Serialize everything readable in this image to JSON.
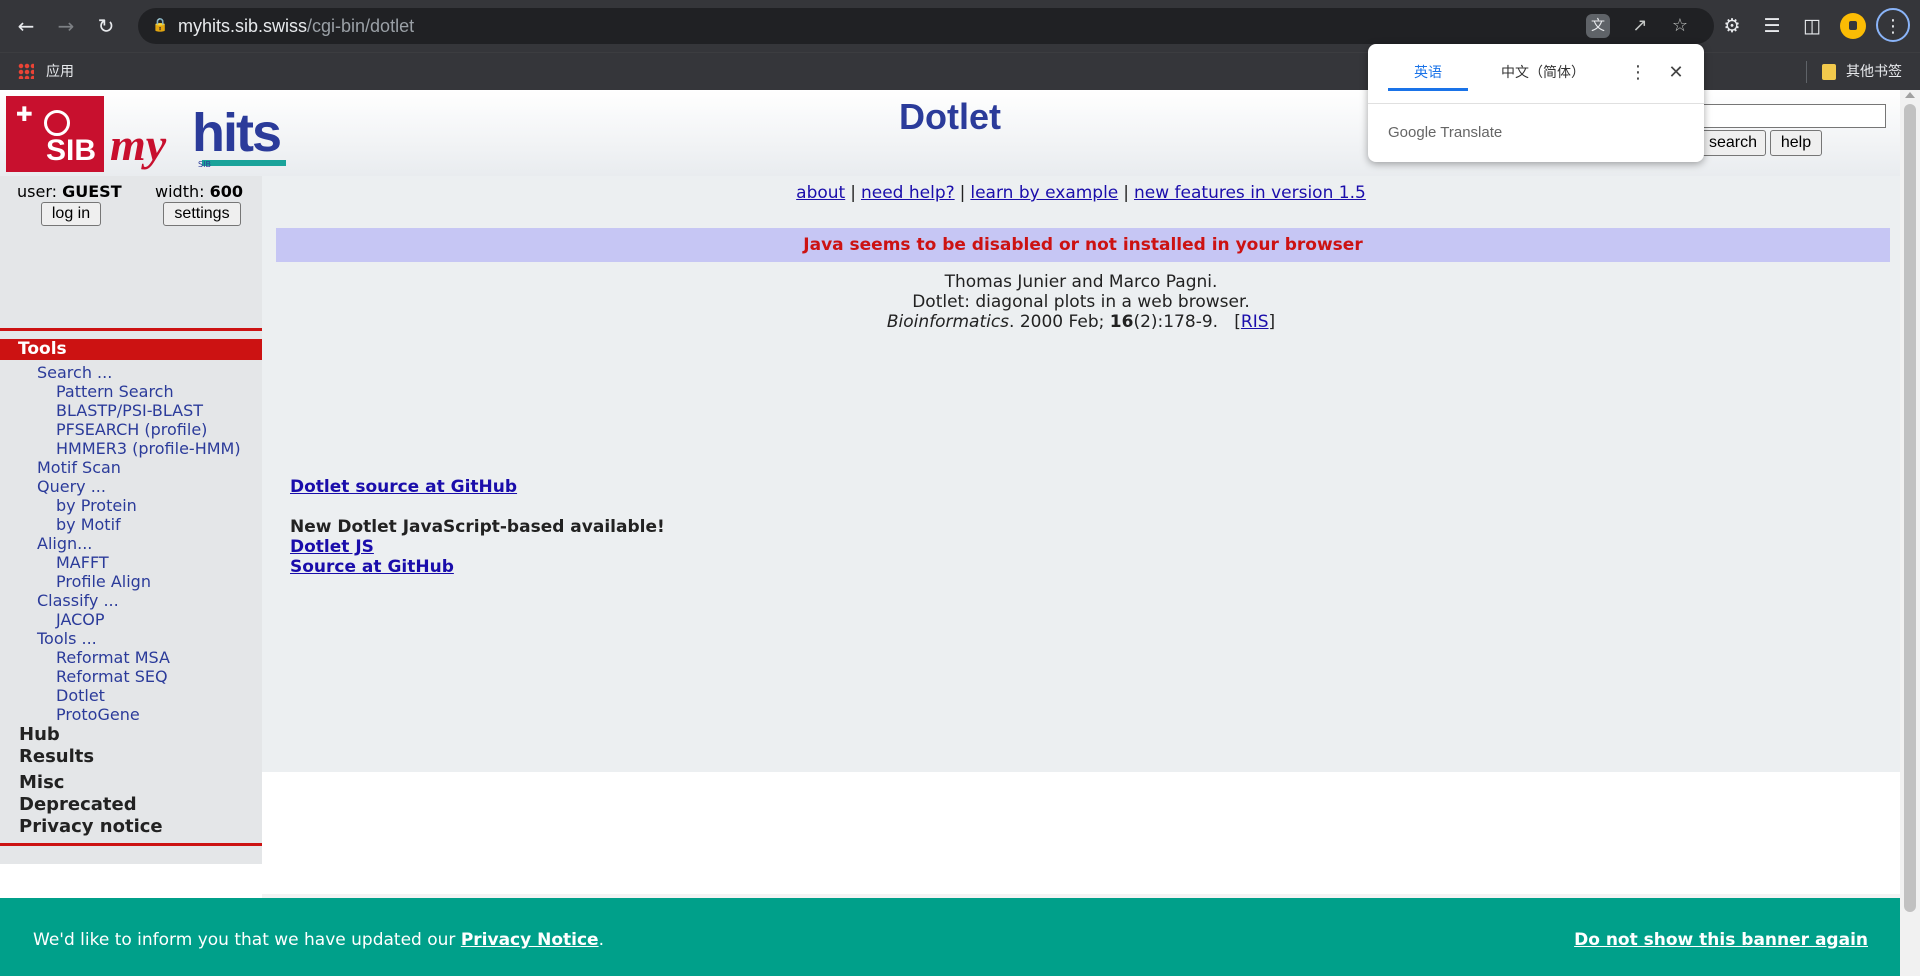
{
  "browser": {
    "url_host": "myhits.sib.swiss",
    "url_path": "/cgi-bin/dotlet",
    "bookmarks": {
      "apps_label": "应用",
      "other_label": "其他书签"
    }
  },
  "translate_popup": {
    "tab_source": "英语",
    "tab_target": "中文（简体）",
    "brand": "Google Translate"
  },
  "header": {
    "title": "Dotlet",
    "logo_sib": "SIB",
    "logo_my": "my",
    "logo_hits": "hits",
    "logo_sub": "SIB",
    "search_button": "search",
    "help_button": "help"
  },
  "sidebar": {
    "user_label": "user:",
    "user_value": "GUEST",
    "width_label": "width:",
    "width_value": "600",
    "login_button": "log in",
    "settings_button": "settings",
    "tools_heading": "Tools",
    "menu": [
      {
        "label": "Search ...",
        "level": 1
      },
      {
        "label": "Pattern Search",
        "level": 2
      },
      {
        "label": "BLASTP/PSI-BLAST",
        "level": 2
      },
      {
        "label": "PFSEARCH (profile)",
        "level": 2
      },
      {
        "label": "HMMER3 (profile-HMM)",
        "level": 2
      },
      {
        "label": "Motif Scan",
        "level": 1
      },
      {
        "label": "Query ...",
        "level": 1
      },
      {
        "label": "by Protein",
        "level": 2
      },
      {
        "label": "by Motif",
        "level": 2
      },
      {
        "label": "Align...",
        "level": 1
      },
      {
        "label": "MAFFT",
        "level": 2
      },
      {
        "label": "Profile Align",
        "level": 2
      },
      {
        "label": "Classify ...",
        "level": 1
      },
      {
        "label": "JACOP",
        "level": 2
      },
      {
        "label": "Tools ...",
        "level": 1
      },
      {
        "label": "Reformat MSA",
        "level": 2
      },
      {
        "label": "Reformat SEQ",
        "level": 2
      },
      {
        "label": "Dotlet",
        "level": 2
      },
      {
        "label": "ProtoGene",
        "level": 2
      }
    ],
    "sections": [
      "Hub",
      "Results",
      "Misc",
      "Deprecated",
      "Privacy notice"
    ]
  },
  "main": {
    "links": [
      "about",
      "need help?",
      "learn by example",
      "new features in version 1.5"
    ],
    "java_warning": "Java seems to be disabled or not installed in your browser",
    "citation": {
      "authors": "Thomas Junier and Marco Pagni.",
      "title": "Dotlet: diagonal plots in a web browser.",
      "journal": "Bioinformatics",
      "details_a": ". 2000 Feb; ",
      "volume": "16",
      "details_b": "(2):178-9.",
      "ris_open": "[",
      "ris": "RIS",
      "ris_close": "]"
    },
    "github_link": "Dotlet source at GitHub",
    "new_notice": "New Dotlet JavaScript-based available!",
    "dotlet_js": "Dotlet JS",
    "source_github": "Source at GitHub"
  },
  "privacy_banner": {
    "message_prefix": "We'd like to inform you that we have updated our ",
    "link": "Privacy Notice",
    "message_suffix": ".",
    "dismiss": "Do not show this banner again"
  },
  "colors": {
    "accent_red": "#cc1212",
    "brand_blue": "#2b3b9a",
    "banner_teal": "#00a08a",
    "java_banner_bg": "#c6c6f4"
  }
}
